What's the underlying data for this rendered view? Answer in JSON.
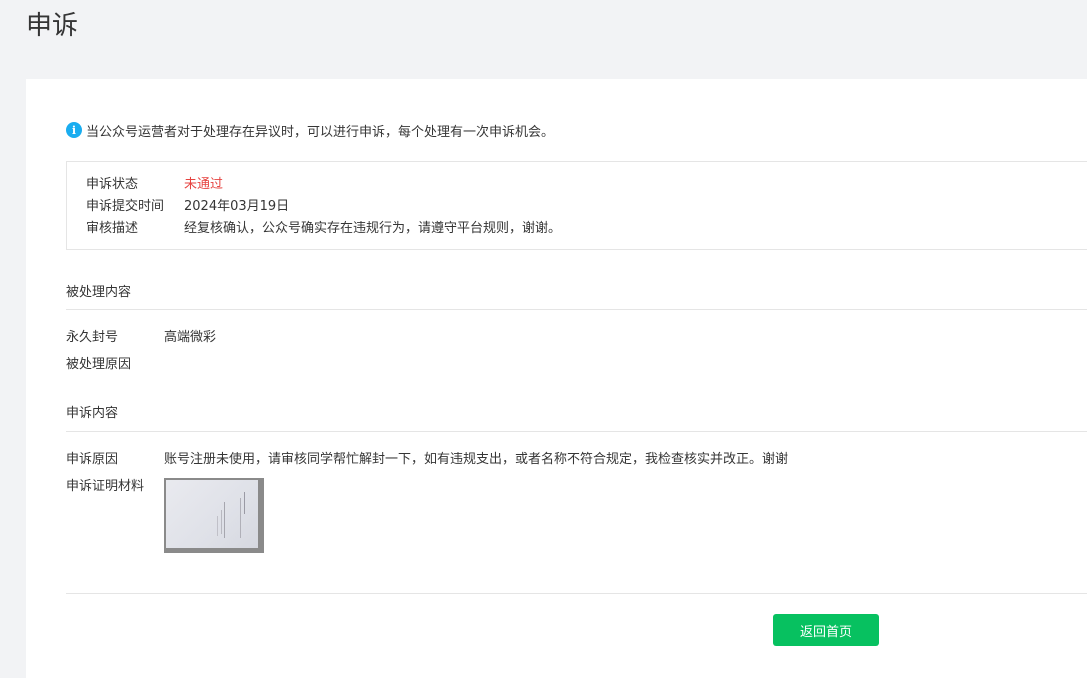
{
  "page": {
    "title": "申诉"
  },
  "notice": {
    "text": "当公众号运营者对于处理存在异议时，可以进行申诉，每个处理有一次申诉机会。",
    "icon": "info-icon"
  },
  "status": {
    "state_label": "申诉状态",
    "state_value": "未通过",
    "submit_time_label": "申诉提交时间",
    "submit_time_value": "2024年03月19日",
    "review_label": "审核描述",
    "review_value": "经复核确认，公众号确实存在违规行为，请遵守平台规则，谢谢。"
  },
  "handled": {
    "section_title": "被处理内容",
    "action_label": "永久封号",
    "action_value": "高端微彩",
    "reason_label": "被处理原因",
    "reason_value": ""
  },
  "appeal": {
    "section_title": "申诉内容",
    "reason_label": "申诉原因",
    "reason_value": "账号注册未使用，请审核同学帮忙解封一下，如有违规支出，或者名称不符合规定，我检查核实并改正。谢谢",
    "evidence_label": "申诉证明材料"
  },
  "actions": {
    "back_label": "返回首页"
  },
  "colors": {
    "fail": "#e64340",
    "primary_button": "#07c160",
    "info_icon": "#1aadf0"
  }
}
